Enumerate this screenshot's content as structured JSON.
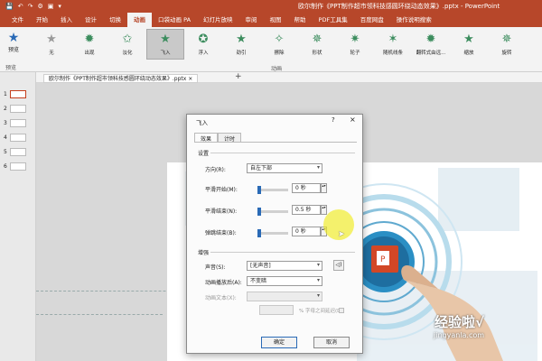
{
  "titlebar": {
    "quick_access": [
      "💾",
      "↶",
      "↷",
      "⚙",
      "▣",
      "▾"
    ],
    "doc_title": "欧尔制作《PPT制作超市领科技感圆环绕动态效果》.pptx - PowerPoint"
  },
  "ribbon_tabs": [
    "文件",
    "开始",
    "插入",
    "设计",
    "切换",
    "动画",
    "口袋动画 PA",
    "幻灯片放映",
    "审阅",
    "视图",
    "帮助",
    "PDF工具集",
    "百度网盘",
    "操作说明搜索"
  ],
  "active_tab_index": 5,
  "ribbon": {
    "preview_label": "预览",
    "preview_group": "预览",
    "animation_group": "动画",
    "animations": [
      {
        "label": "无",
        "icon": "★",
        "style": "grey"
      },
      {
        "label": "出现",
        "icon": "✹",
        "style": "green"
      },
      {
        "label": "淡化",
        "icon": "✩",
        "style": "green"
      },
      {
        "label": "飞入",
        "icon": "★",
        "style": "green"
      },
      {
        "label": "浮入",
        "icon": "✪",
        "style": "green"
      },
      {
        "label": "劲引",
        "icon": "★",
        "style": "green"
      },
      {
        "label": "擦除",
        "icon": "✧",
        "style": "green"
      },
      {
        "label": "形状",
        "icon": "✵",
        "style": "green"
      },
      {
        "label": "轮子",
        "icon": "✷",
        "style": "green"
      },
      {
        "label": "随机线条",
        "icon": "✶",
        "style": "green"
      },
      {
        "label": "翻转式由远...",
        "icon": "✹",
        "style": "green"
      },
      {
        "label": "缩放",
        "icon": "★",
        "style": "green"
      },
      {
        "label": "旋转",
        "icon": "✵",
        "style": "green"
      }
    ],
    "selected_animation_index": 3
  },
  "thumbnails": [
    "1",
    "2",
    "3",
    "4",
    "5",
    "6"
  ],
  "doc_tab": {
    "label": "欧尔制作《PPT制作超市领科技感圆环绕动态效果》.pptx",
    "close": "×",
    "add": "+"
  },
  "dialog": {
    "title": "飞入",
    "help": "?",
    "close": "×",
    "tabs": [
      "效果",
      "计时"
    ],
    "settings_label": "设置",
    "direction_label": "方向(R):",
    "direction_value": "自左下部",
    "smooth_start_label": "平滑开始(M):",
    "smooth_start_value": "0 秒",
    "smooth_end_label": "平滑结束(N):",
    "smooth_end_value": "0.5 秒",
    "bounce_end_label": "弹跳结束(B):",
    "bounce_end_value": "0 秒",
    "enhance_label": "增强",
    "sound_label": "声音(S):",
    "sound_value": "[无声音]",
    "after_anim_label": "动画播放后(A):",
    "after_anim_value": "不变暗",
    "anim_text_label": "动画文本(X):",
    "anim_text_value": "",
    "delay_hint": "% 字母之间延迟(D)",
    "ok": "确定",
    "cancel": "取消"
  },
  "watermark": {
    "line1": "经验啦√",
    "line2": "jingyanla.com"
  }
}
